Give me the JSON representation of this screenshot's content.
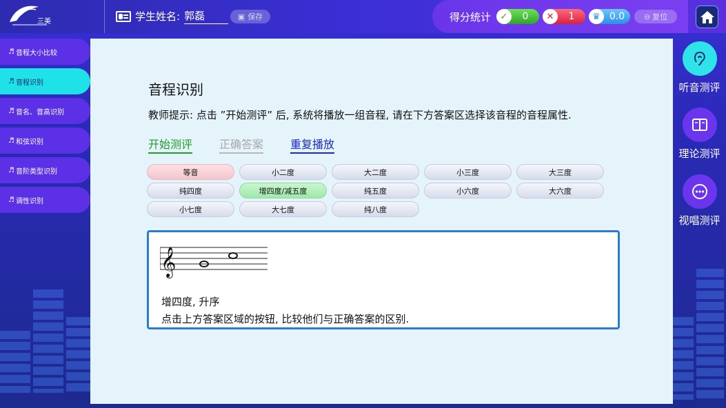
{
  "header": {
    "logo_text": "三美",
    "student_label": "学生姓名:",
    "student_name": "郭磊",
    "save_label": "保存",
    "score_label": "得分统计",
    "correct_count": "0",
    "wrong_count": "1",
    "score_value": "0.0",
    "reset_label": "复位"
  },
  "sidebar": {
    "items": [
      {
        "label": "音程大小比较",
        "active": false
      },
      {
        "label": "音程识别",
        "active": true
      },
      {
        "label": "音名、音高识别",
        "active": false
      },
      {
        "label": "和弦识别",
        "active": false
      },
      {
        "label": "音阶类型识别",
        "active": false
      },
      {
        "label": "调性识别",
        "active": false
      }
    ]
  },
  "main": {
    "title": "音程识别",
    "hint": "教师提示: 点击 ”开始测评” 后, 系统将播放一组音程, 请在下方答案区选择该音程的音程属性.",
    "actions": {
      "start": "开始测评",
      "correct_answer": "正确答案",
      "replay": "重复播放"
    },
    "choices": [
      {
        "label": "等音",
        "state": "wrong"
      },
      {
        "label": "小二度",
        "state": "normal"
      },
      {
        "label": "大二度",
        "state": "normal"
      },
      {
        "label": "小三度",
        "state": "normal"
      },
      {
        "label": "大三度",
        "state": "normal"
      },
      {
        "label": "纯四度",
        "state": "normal"
      },
      {
        "label": "增四度/减五度",
        "state": "right"
      },
      {
        "label": "纯五度",
        "state": "normal"
      },
      {
        "label": "小六度",
        "state": "normal"
      },
      {
        "label": "大六度",
        "state": "normal"
      },
      {
        "label": "小七度",
        "state": "normal"
      },
      {
        "label": "大七度",
        "state": "normal"
      },
      {
        "label": "纯八度",
        "state": "normal"
      }
    ],
    "answer": {
      "line1": "增四度, 升序",
      "line2": "点击上方答案区域的按钮, 比较他们与正确答案的区别."
    }
  },
  "right_nav": {
    "items": [
      {
        "label": "听音测评",
        "icon": "ear-icon"
      },
      {
        "label": "理论测评",
        "icon": "book-icon"
      },
      {
        "label": "视唱测评",
        "icon": "more-icon"
      }
    ]
  },
  "colors": {
    "accent_cyan": "#2ee4ea",
    "sidebar_purple": "#5b30e6",
    "answer_border": "#2a7bd6",
    "start_green": "#1e9b2a",
    "replay_blue": "#1a28c8"
  }
}
